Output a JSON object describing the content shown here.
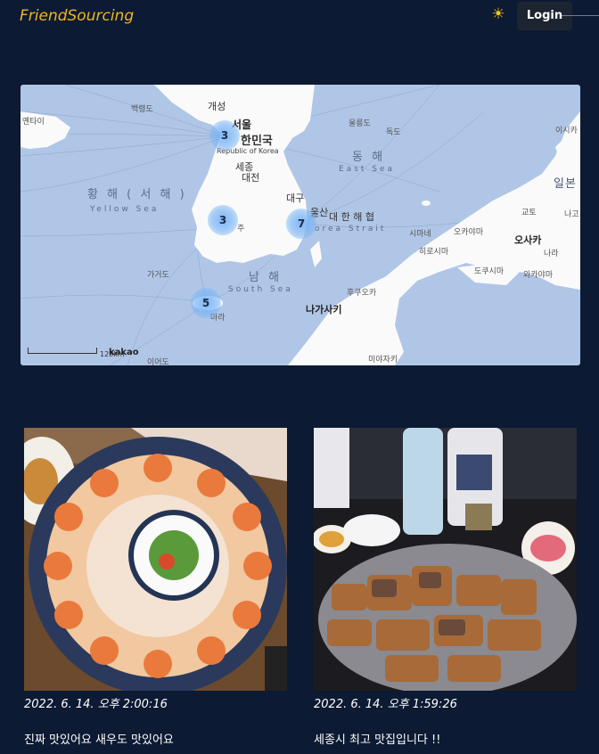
{
  "header": {
    "logo": "FriendSourcing",
    "theme_icon": "sun-icon",
    "login_label": "Login"
  },
  "map": {
    "labels": {
      "seoul": "서울",
      "country_ko": "한민국",
      "country_en": "Republic of Korea",
      "sejong": "세종",
      "daejeon": "대전",
      "daegu": "대구",
      "ulsan": "울산",
      "kaesong": "개성",
      "baengnyeong": "백령도",
      "yeonti": "옌타이",
      "ulleung": "울릉도",
      "dokdo": "독도",
      "isikawa": "이시카",
      "east_sea_ko": "동 해",
      "east_sea_en": "East Sea",
      "yellow_sea_ko": "황 해 ( 서 해 )",
      "yellow_sea_en": "Yellow Sea",
      "korea_strait_ko": "대 한 해 협",
      "korea_strait_en": "orea Strait",
      "south_sea_ko": "남 해",
      "south_sea_en": "South Sea",
      "gageodo": "가거도",
      "nagasaki": "나가사키",
      "fukuoka": "후쿠오카",
      "hiroshima": "히로시마",
      "shimane": "시마네",
      "okayama": "오카야마",
      "osaka": "오사카",
      "kyoto": "교토",
      "nara": "나라",
      "nagoya": "나고",
      "japan": "일본",
      "dokushima": "도쿠시마",
      "wakayama": "와카야마",
      "miyazaki": "미야자키",
      "ieodo": "이어도",
      "jeju_frag": "주",
      "marado": "마라"
    },
    "clusters": [
      "3",
      "3",
      "7",
      "5"
    ],
    "scale_label": "128km",
    "brand": "kakao"
  },
  "posts": [
    {
      "date": "2022. 6. 14. 오후 2:00:16",
      "text": "진짜 맛있어요 새우도 맛있어요"
    },
    {
      "date": "2022. 6. 14. 오후 1:59:26",
      "text": "세종시 최고 맛집입니다 !!"
    }
  ]
}
